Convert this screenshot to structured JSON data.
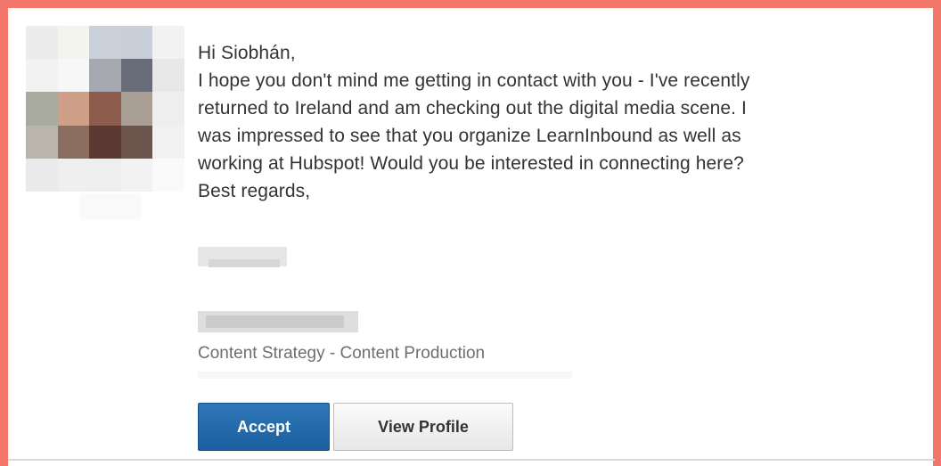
{
  "invitation": {
    "greeting": "Hi Siobhán,",
    "body_lines": [
      "I hope you don't mind me getting in contact with you - I've recently",
      "returned to Ireland and am checking out the digital media scene. I",
      "was impressed to see that you organize LearnInbound as well as",
      "working at Hubspot! Would you be interested in connecting here?",
      "Best regards,"
    ],
    "sender_headline": "Content Strategy - Content Production",
    "accept_label": "Accept",
    "view_profile_label": "View Profile"
  },
  "colors": {
    "frame_border": "#f2776a",
    "accept_bg": "#2470b3",
    "text": "#333333",
    "muted_text": "#6e6e6e"
  },
  "avatar_pixels": [
    "#ececec",
    "#f4f4ee",
    "#c9d0d9",
    "#c8cfd8",
    "#f2f2f2",
    "#f2f2f2",
    "#f7f7f7",
    "#a6a8b0",
    "#686b78",
    "#e8e8e8",
    "#a8aa9e",
    "#cf9f88",
    "#8e5c4c",
    "#a89e94",
    "#eeeeee",
    "#bbb4aa",
    "#8a6d5e",
    "#5c3a33",
    "#6a544b",
    "#f1f1f1",
    "#eaeaea",
    "#f0efef",
    "#eeeeee",
    "#f2f2f2",
    "#fafafa"
  ]
}
